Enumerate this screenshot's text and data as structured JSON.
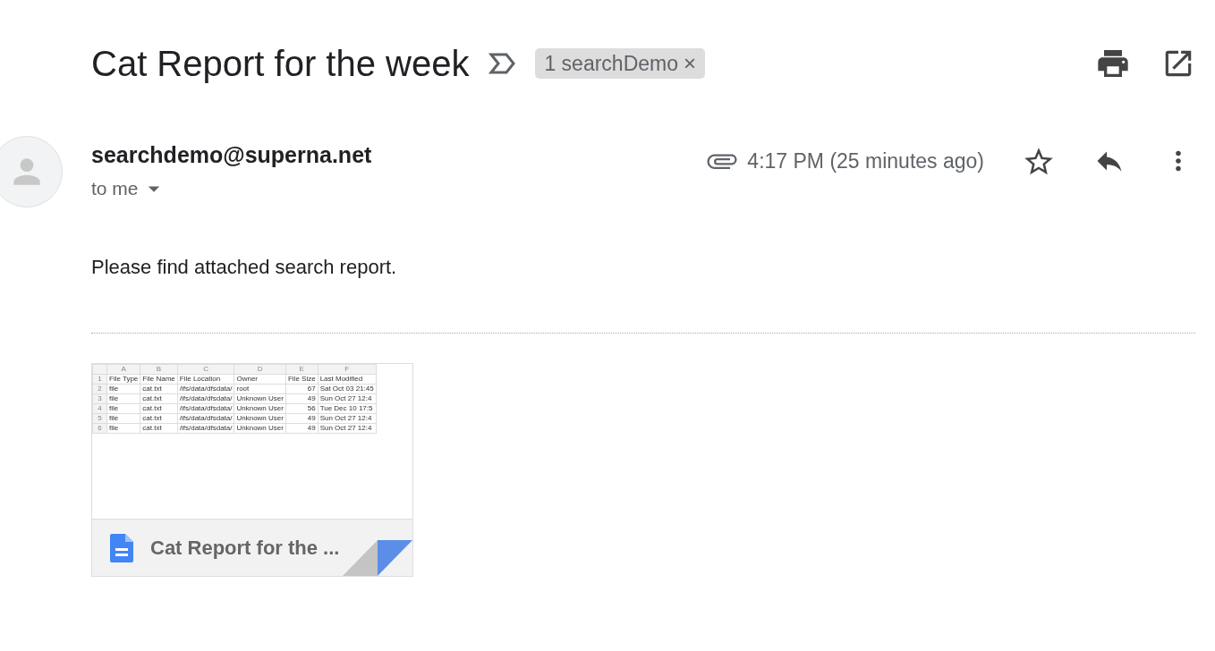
{
  "subject": "Cat Report for the week",
  "label_chip": {
    "text": "1 searchDemo",
    "remove": "×"
  },
  "sender": {
    "email": "searchdemo@superna.net",
    "recipient": "to me"
  },
  "time": "4:17 PM (25 minutes ago)",
  "starred": false,
  "body": "Please find attached search report.",
  "attachment": {
    "name": "Cat Report for the ...",
    "sheet": {
      "columns": [
        "A",
        "B",
        "C",
        "D",
        "E",
        "F"
      ],
      "rows": [
        {
          "num": "1",
          "cells": [
            "File Type",
            "File Name",
            "File Location",
            "Owner",
            "File Size",
            "Last Modified"
          ]
        },
        {
          "num": "2",
          "cells": [
            "file",
            "cat.txt",
            "/ifs/data/dfsdata/",
            "root",
            "67",
            "Sat Oct 03 21:45"
          ]
        },
        {
          "num": "3",
          "cells": [
            "file",
            "cat.txt",
            "/ifs/data/dfsdata/",
            "Unknown User",
            "49",
            "Sun Oct 27 12:4"
          ]
        },
        {
          "num": "4",
          "cells": [
            "file",
            "cat.txt",
            "/ifs/data/dfsdata/",
            "Unknown User",
            "56",
            "Tue Dec 10 17:5"
          ]
        },
        {
          "num": "5",
          "cells": [
            "file",
            "cat.txt",
            "/ifs/data/dfsdata/",
            "Unknown User",
            "49",
            "Sun Oct 27 12:4"
          ]
        },
        {
          "num": "6",
          "cells": [
            "file",
            "cat.txt",
            "/ifs/data/dfsdata/",
            "Unknown User",
            "49",
            "Sun Oct 27 12:4"
          ]
        }
      ]
    }
  }
}
